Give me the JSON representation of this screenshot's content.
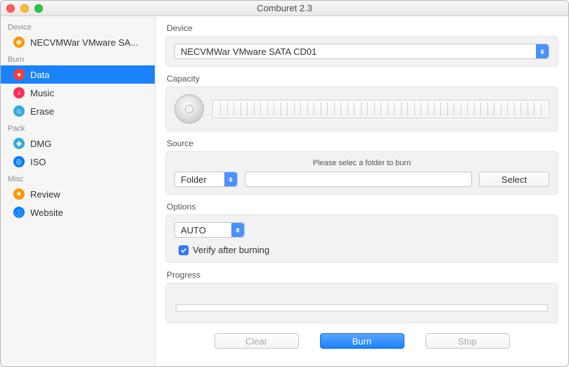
{
  "window": {
    "title": "Comburet 2.3"
  },
  "sidebar": {
    "groups": [
      {
        "label": "Device",
        "items": [
          {
            "label": "NECVMWar VMware SA...",
            "icon": "device"
          }
        ]
      },
      {
        "label": "Burn",
        "items": [
          {
            "label": "Data",
            "icon": "data",
            "selected": true
          },
          {
            "label": "Music",
            "icon": "music"
          },
          {
            "label": "Erase",
            "icon": "erase"
          }
        ]
      },
      {
        "label": "Pack",
        "items": [
          {
            "label": "DMG",
            "icon": "dmg"
          },
          {
            "label": "ISO",
            "icon": "iso"
          }
        ]
      },
      {
        "label": "Misc",
        "items": [
          {
            "label": "Review",
            "icon": "review"
          },
          {
            "label": "Website",
            "icon": "website"
          }
        ]
      }
    ]
  },
  "main": {
    "device": {
      "label": "Device",
      "selected": "NECVMWar VMware SATA CD01"
    },
    "capacity": {
      "label": "Capacity"
    },
    "source": {
      "label": "Source",
      "hint": "Please selec a folder to burn",
      "type_selected": "Folder",
      "path": "",
      "select_btn": "Select"
    },
    "options": {
      "label": "Options",
      "mode_selected": "AUTO",
      "verify_label": "Verify after burning",
      "verify_checked": true
    },
    "progress": {
      "label": "Progress"
    },
    "actions": {
      "clear": "Clear",
      "burn": "Burn",
      "stop": "Stop"
    }
  }
}
